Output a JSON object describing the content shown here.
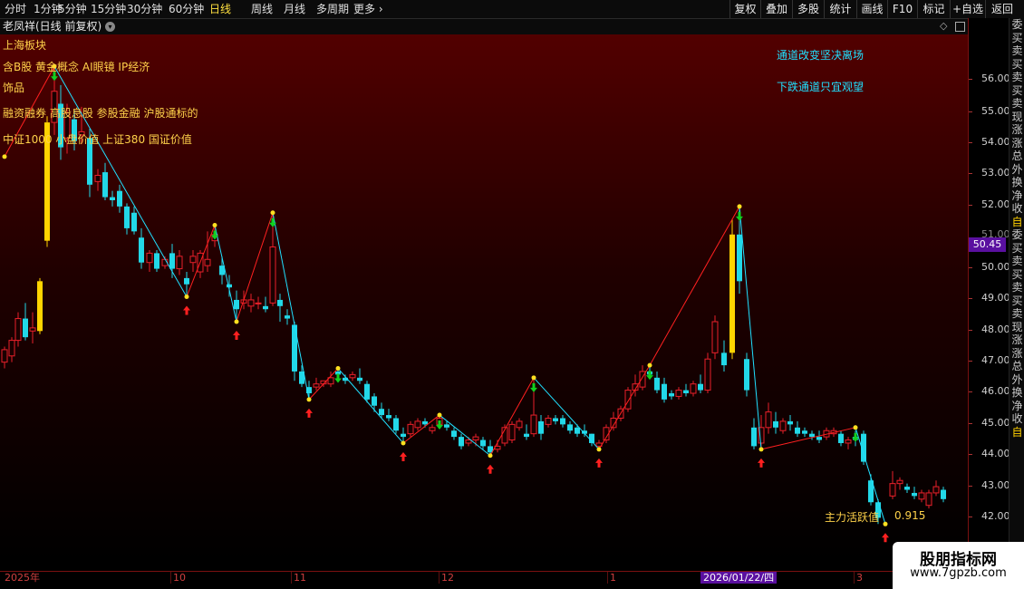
{
  "period_tabs": [
    {
      "label": "分时",
      "active": false
    },
    {
      "label": "1分钟",
      "active": false
    },
    {
      "label": "5分钟",
      "active": false
    },
    {
      "label": "15分钟",
      "active": false
    },
    {
      "label": "30分钟",
      "active": false
    },
    {
      "label": "60分钟",
      "active": false
    },
    {
      "label": "日线",
      "active": true
    },
    {
      "label": "周线",
      "active": false
    },
    {
      "label": "月线",
      "active": false
    },
    {
      "label": "多周期",
      "active": false
    },
    {
      "label": "更多 ›",
      "active": false
    }
  ],
  "toolbar": [
    "复权",
    "叠加",
    "多股",
    "统计",
    "画线",
    "F10",
    "标记",
    "+自选",
    "返回"
  ],
  "stock_title": "老凤祥(日线 前复权)",
  "annotations": {
    "lines": [
      "上海板块",
      "含B股 黄金概念 AI眼镜 IP经济",
      "饰品",
      "融资融券 高股息股 参股金融 沪股通标的",
      "中证1000 小盘价值 上证380 国证价值"
    ],
    "channel_msgs": [
      "通道改变坚决离场",
      "下跌通道只宜观望"
    ]
  },
  "indicator": {
    "label": "主力活跃值",
    "value": "0.915"
  },
  "price_axis": {
    "ticks": [
      "56.00",
      "55.00",
      "54.00",
      "53.00",
      "52.00",
      "51.00",
      "50.00",
      "49.00",
      "48.00",
      "47.00",
      "46.00",
      "45.00",
      "44.00",
      "43.00",
      "42.00"
    ],
    "current": "50.45"
  },
  "date_axis": {
    "labels": [
      "2025年",
      "10",
      "11",
      "12",
      "1",
      "3"
    ],
    "highlight": "2026/01/22/四"
  },
  "right_strip": [
    "委",
    "买",
    "卖",
    "买",
    "卖",
    "买",
    "卖",
    "现",
    "涨",
    "涨",
    "总",
    "外",
    "换",
    "净",
    "收",
    "自",
    "委",
    "买",
    "卖",
    "买",
    "卖",
    "买",
    "卖",
    "现",
    "涨",
    "涨",
    "总",
    "外",
    "换",
    "净",
    "收",
    "自"
  ],
  "watermark": {
    "title": "股朋指标网",
    "url": "www.7gpzb.com"
  },
  "colors": {
    "up": "#e8202a",
    "down": "#22d8e8",
    "limit_up": "#ffd400",
    "zigzag_up": "#ff2020",
    "zigzag_down": "#20e0ff",
    "buy_arrow": "#ff2020",
    "sell_arrow": "#10d020"
  },
  "chart_data": {
    "type": "candlestick",
    "ylim": [
      41.5,
      57.2
    ],
    "candles": [
      {
        "x": 5,
        "o": 46.9,
        "h": 47.4,
        "l": 46.7,
        "c": 47.3
      },
      {
        "x": 13,
        "o": 47.1,
        "h": 47.7,
        "l": 46.9,
        "c": 47.6
      },
      {
        "x": 20,
        "o": 47.6,
        "h": 48.5,
        "l": 47.4,
        "c": 48.3
      },
      {
        "x": 28,
        "o": 48.3,
        "h": 48.8,
        "l": 47.6,
        "c": 47.7
      },
      {
        "x": 36,
        "o": 47.9,
        "h": 48.5,
        "l": 47.5,
        "c": 48.0
      },
      {
        "x": 44,
        "o": 47.9,
        "h": 49.6,
        "l": 47.8,
        "c": 49.5
      },
      {
        "x": 52,
        "o": 50.8,
        "h": 54.8,
        "l": 50.6,
        "c": 54.6
      },
      {
        "x": 60,
        "o": 54.6,
        "h": 56.4,
        "l": 54.2,
        "c": 55.6
      },
      {
        "x": 67,
        "o": 55.2,
        "h": 55.8,
        "l": 53.4,
        "c": 53.8
      },
      {
        "x": 74,
        "o": 54.1,
        "h": 55.2,
        "l": 53.6,
        "c": 54.9
      },
      {
        "x": 82,
        "o": 54.7,
        "h": 55.0,
        "l": 53.7,
        "c": 54.0
      },
      {
        "x": 90,
        "o": 54.2,
        "h": 55.1,
        "l": 53.9,
        "c": 54.3
      },
      {
        "x": 99,
        "o": 54.1,
        "h": 54.4,
        "l": 52.2,
        "c": 52.6
      },
      {
        "x": 108,
        "o": 52.7,
        "h": 53.1,
        "l": 52.4,
        "c": 52.9
      },
      {
        "x": 116,
        "o": 53.0,
        "h": 53.3,
        "l": 52.1,
        "c": 52.2
      },
      {
        "x": 124,
        "o": 52.2,
        "h": 52.4,
        "l": 51.9,
        "c": 52.1
      },
      {
        "x": 132,
        "o": 52.4,
        "h": 52.6,
        "l": 51.7,
        "c": 51.9
      },
      {
        "x": 140,
        "o": 51.9,
        "h": 52.0,
        "l": 51.0,
        "c": 51.2
      },
      {
        "x": 148,
        "o": 51.7,
        "h": 51.9,
        "l": 51.0,
        "c": 51.1
      },
      {
        "x": 156,
        "o": 50.9,
        "h": 51.2,
        "l": 49.9,
        "c": 50.1
      },
      {
        "x": 165,
        "o": 50.1,
        "h": 50.5,
        "l": 49.8,
        "c": 50.4
      },
      {
        "x": 173,
        "o": 50.4,
        "h": 50.5,
        "l": 49.8,
        "c": 49.9
      },
      {
        "x": 182,
        "o": 50.0,
        "h": 50.3,
        "l": 49.9,
        "c": 50.2
      },
      {
        "x": 190,
        "o": 50.4,
        "h": 50.7,
        "l": 49.6,
        "c": 49.9
      },
      {
        "x": 198,
        "o": 49.9,
        "h": 50.5,
        "l": 49.7,
        "c": 50.3
      },
      {
        "x": 206,
        "o": 49.6,
        "h": 49.8,
        "l": 49.0,
        "c": 49.4
      },
      {
        "x": 213,
        "o": 50.1,
        "h": 50.5,
        "l": 49.8,
        "c": 50.3
      },
      {
        "x": 221,
        "o": 49.8,
        "h": 50.5,
        "l": 49.6,
        "c": 50.4
      },
      {
        "x": 229,
        "o": 50.0,
        "h": 51.1,
        "l": 49.8,
        "c": 50.2
      },
      {
        "x": 237,
        "o": 50.8,
        "h": 51.3,
        "l": 50.6,
        "c": 51.0
      },
      {
        "x": 245,
        "o": 50.0,
        "h": 50.3,
        "l": 49.4,
        "c": 49.7
      },
      {
        "x": 253,
        "o": 49.4,
        "h": 49.7,
        "l": 49.0,
        "c": 49.3
      },
      {
        "x": 261,
        "o": 48.9,
        "h": 49.2,
        "l": 48.2,
        "c": 48.6
      },
      {
        "x": 269,
        "o": 48.8,
        "h": 49.2,
        "l": 48.6,
        "c": 48.9
      },
      {
        "x": 277,
        "o": 48.7,
        "h": 49.1,
        "l": 48.5,
        "c": 48.9
      },
      {
        "x": 285,
        "o": 48.8,
        "h": 49.0,
        "l": 48.6,
        "c": 48.8
      },
      {
        "x": 293,
        "o": 48.7,
        "h": 49.0,
        "l": 48.5,
        "c": 48.6
      },
      {
        "x": 301,
        "o": 48.8,
        "h": 51.7,
        "l": 48.7,
        "c": 50.6
      },
      {
        "x": 309,
        "o": 48.9,
        "h": 49.1,
        "l": 48.2,
        "c": 48.7
      },
      {
        "x": 317,
        "o": 48.4,
        "h": 48.6,
        "l": 48.1,
        "c": 48.3
      },
      {
        "x": 325,
        "o": 48.1,
        "h": 48.2,
        "l": 46.3,
        "c": 46.6
      },
      {
        "x": 333,
        "o": 46.6,
        "h": 46.8,
        "l": 46.1,
        "c": 46.2
      },
      {
        "x": 341,
        "o": 46.1,
        "h": 46.3,
        "l": 45.7,
        "c": 45.9
      },
      {
        "x": 349,
        "o": 46.1,
        "h": 46.4,
        "l": 46.0,
        "c": 46.2
      },
      {
        "x": 357,
        "o": 46.2,
        "h": 46.3,
        "l": 46.1,
        "c": 46.3
      },
      {
        "x": 365,
        "o": 46.2,
        "h": 46.6,
        "l": 46.1,
        "c": 46.4
      },
      {
        "x": 373,
        "o": 46.6,
        "h": 46.7,
        "l": 46.3,
        "c": 46.5
      },
      {
        "x": 381,
        "o": 46.4,
        "h": 46.5,
        "l": 46.2,
        "c": 46.3
      },
      {
        "x": 389,
        "o": 46.4,
        "h": 46.6,
        "l": 46.3,
        "c": 46.5
      },
      {
        "x": 397,
        "o": 46.4,
        "h": 46.7,
        "l": 46.2,
        "c": 46.3
      },
      {
        "x": 405,
        "o": 46.2,
        "h": 46.3,
        "l": 45.6,
        "c": 45.7
      },
      {
        "x": 413,
        "o": 45.8,
        "h": 45.9,
        "l": 45.3,
        "c": 45.5
      },
      {
        "x": 421,
        "o": 45.4,
        "h": 45.6,
        "l": 45.1,
        "c": 45.2
      },
      {
        "x": 429,
        "o": 45.2,
        "h": 45.4,
        "l": 45.0,
        "c": 45.1
      },
      {
        "x": 437,
        "o": 45.1,
        "h": 45.2,
        "l": 44.6,
        "c": 44.7
      },
      {
        "x": 445,
        "o": 44.6,
        "h": 44.8,
        "l": 44.3,
        "c": 44.5
      },
      {
        "x": 453,
        "o": 44.6,
        "h": 45.0,
        "l": 44.5,
        "c": 44.9
      },
      {
        "x": 461,
        "o": 44.8,
        "h": 45.1,
        "l": 44.7,
        "c": 45.0
      },
      {
        "x": 469,
        "o": 45.0,
        "h": 45.1,
        "l": 44.8,
        "c": 44.9
      },
      {
        "x": 477,
        "o": 44.7,
        "h": 44.9,
        "l": 44.6,
        "c": 44.8
      },
      {
        "x": 485,
        "o": 44.9,
        "h": 45.2,
        "l": 44.8,
        "c": 45.1
      },
      {
        "x": 493,
        "o": 44.9,
        "h": 45.0,
        "l": 44.7,
        "c": 44.8
      },
      {
        "x": 501,
        "o": 44.7,
        "h": 44.8,
        "l": 44.4,
        "c": 44.5
      },
      {
        "x": 509,
        "o": 44.5,
        "h": 44.6,
        "l": 44.1,
        "c": 44.2
      },
      {
        "x": 517,
        "o": 44.3,
        "h": 44.5,
        "l": 44.2,
        "c": 44.4
      },
      {
        "x": 525,
        "o": 44.4,
        "h": 44.6,
        "l": 44.2,
        "c": 44.5
      },
      {
        "x": 533,
        "o": 44.4,
        "h": 44.5,
        "l": 44.1,
        "c": 44.2
      },
      {
        "x": 541,
        "o": 44.2,
        "h": 44.4,
        "l": 43.9,
        "c": 44.0
      },
      {
        "x": 549,
        "o": 44.1,
        "h": 44.4,
        "l": 44.0,
        "c": 44.2
      },
      {
        "x": 557,
        "o": 44.3,
        "h": 44.9,
        "l": 44.2,
        "c": 44.8
      },
      {
        "x": 565,
        "o": 44.4,
        "h": 45.0,
        "l": 44.3,
        "c": 44.9
      },
      {
        "x": 573,
        "o": 44.8,
        "h": 45.1,
        "l": 44.7,
        "c": 45.0
      },
      {
        "x": 581,
        "o": 44.6,
        "h": 44.9,
        "l": 44.4,
        "c": 44.5
      },
      {
        "x": 589,
        "o": 44.6,
        "h": 46.4,
        "l": 44.5,
        "c": 45.2
      },
      {
        "x": 597,
        "o": 45.0,
        "h": 45.2,
        "l": 44.4,
        "c": 44.6
      },
      {
        "x": 605,
        "o": 44.9,
        "h": 45.2,
        "l": 44.8,
        "c": 45.1
      },
      {
        "x": 613,
        "o": 45.1,
        "h": 45.2,
        "l": 44.9,
        "c": 45.0
      },
      {
        "x": 621,
        "o": 45.1,
        "h": 45.2,
        "l": 44.8,
        "c": 44.9
      },
      {
        "x": 629,
        "o": 44.9,
        "h": 45.0,
        "l": 44.6,
        "c": 44.7
      },
      {
        "x": 637,
        "o": 44.8,
        "h": 44.9,
        "l": 44.5,
        "c": 44.6
      },
      {
        "x": 645,
        "o": 44.7,
        "h": 44.9,
        "l": 44.5,
        "c": 44.6
      },
      {
        "x": 653,
        "o": 44.6,
        "h": 44.6,
        "l": 44.2,
        "c": 44.3
      },
      {
        "x": 661,
        "o": 44.2,
        "h": 44.4,
        "l": 44.1,
        "c": 44.3
      },
      {
        "x": 669,
        "o": 44.4,
        "h": 44.9,
        "l": 44.3,
        "c": 44.8
      },
      {
        "x": 677,
        "o": 44.8,
        "h": 45.3,
        "l": 44.7,
        "c": 45.1
      },
      {
        "x": 685,
        "o": 45.1,
        "h": 45.5,
        "l": 45.0,
        "c": 45.4
      },
      {
        "x": 693,
        "o": 45.4,
        "h": 46.1,
        "l": 45.3,
        "c": 46.0
      },
      {
        "x": 701,
        "o": 46.0,
        "h": 46.5,
        "l": 45.8,
        "c": 46.2
      },
      {
        "x": 709,
        "o": 46.1,
        "h": 46.8,
        "l": 46.0,
        "c": 46.6
      },
      {
        "x": 717,
        "o": 46.6,
        "h": 46.8,
        "l": 46.4,
        "c": 46.5
      },
      {
        "x": 725,
        "o": 46.4,
        "h": 46.6,
        "l": 45.9,
        "c": 46.0
      },
      {
        "x": 733,
        "o": 46.2,
        "h": 46.4,
        "l": 45.6,
        "c": 45.7
      },
      {
        "x": 741,
        "o": 45.9,
        "h": 46.0,
        "l": 45.7,
        "c": 45.8
      },
      {
        "x": 749,
        "o": 45.8,
        "h": 46.1,
        "l": 45.7,
        "c": 46.0
      },
      {
        "x": 757,
        "o": 46.0,
        "h": 46.2,
        "l": 45.8,
        "c": 45.9
      },
      {
        "x": 765,
        "o": 45.9,
        "h": 46.3,
        "l": 45.8,
        "c": 46.2
      },
      {
        "x": 773,
        "o": 46.2,
        "h": 46.5,
        "l": 45.9,
        "c": 46.0
      },
      {
        "x": 781,
        "o": 46.0,
        "h": 47.2,
        "l": 45.9,
        "c": 47.0
      },
      {
        "x": 789,
        "o": 47.2,
        "h": 48.4,
        "l": 47.0,
        "c": 48.2
      },
      {
        "x": 799,
        "o": 47.2,
        "h": 47.6,
        "l": 46.6,
        "c": 46.8
      },
      {
        "x": 808,
        "o": 47.2,
        "h": 51.5,
        "l": 47.0,
        "c": 51.0
      },
      {
        "x": 816,
        "o": 51.0,
        "h": 51.9,
        "l": 49.1,
        "c": 49.5
      },
      {
        "x": 824,
        "o": 47.0,
        "h": 47.2,
        "l": 45.8,
        "c": 46.0
      },
      {
        "x": 832,
        "o": 44.8,
        "h": 45.1,
        "l": 44.1,
        "c": 44.2
      },
      {
        "x": 840,
        "o": 44.3,
        "h": 45.2,
        "l": 44.1,
        "c": 44.8
      },
      {
        "x": 848,
        "o": 44.8,
        "h": 45.6,
        "l": 44.6,
        "c": 45.3
      },
      {
        "x": 856,
        "o": 45.0,
        "h": 45.3,
        "l": 44.6,
        "c": 44.8
      },
      {
        "x": 864,
        "o": 44.7,
        "h": 45.1,
        "l": 44.6,
        "c": 45.0
      },
      {
        "x": 872,
        "o": 45.0,
        "h": 45.2,
        "l": 44.7,
        "c": 44.9
      },
      {
        "x": 880,
        "o": 44.8,
        "h": 45.0,
        "l": 44.5,
        "c": 44.6
      },
      {
        "x": 888,
        "o": 44.7,
        "h": 44.8,
        "l": 44.5,
        "c": 44.6
      },
      {
        "x": 896,
        "o": 44.6,
        "h": 44.7,
        "l": 44.4,
        "c": 44.5
      },
      {
        "x": 904,
        "o": 44.5,
        "h": 44.7,
        "l": 44.3,
        "c": 44.4
      },
      {
        "x": 912,
        "o": 44.5,
        "h": 44.8,
        "l": 44.4,
        "c": 44.7
      },
      {
        "x": 920,
        "o": 44.6,
        "h": 44.8,
        "l": 44.5,
        "c": 44.7
      },
      {
        "x": 928,
        "o": 44.6,
        "h": 44.7,
        "l": 44.2,
        "c": 44.3
      },
      {
        "x": 936,
        "o": 44.3,
        "h": 44.5,
        "l": 44.1,
        "c": 44.4
      },
      {
        "x": 944,
        "o": 44.5,
        "h": 44.7,
        "l": 44.2,
        "c": 44.4
      },
      {
        "x": 953,
        "o": 44.6,
        "h": 44.7,
        "l": 43.6,
        "c": 43.7
      },
      {
        "x": 961,
        "o": 43.1,
        "h": 43.3,
        "l": 42.3,
        "c": 42.4
      },
      {
        "x": 969,
        "o": 42.4,
        "h": 42.5,
        "l": 41.7,
        "c": 41.9
      },
      {
        "x": 985,
        "o": 42.6,
        "h": 43.4,
        "l": 42.5,
        "c": 43.0
      },
      {
        "x": 993,
        "o": 43.0,
        "h": 43.2,
        "l": 42.8,
        "c": 43.1
      },
      {
        "x": 1001,
        "o": 42.9,
        "h": 43.0,
        "l": 42.7,
        "c": 42.8
      },
      {
        "x": 1009,
        "o": 42.7,
        "h": 42.9,
        "l": 42.5,
        "c": 42.6
      },
      {
        "x": 1017,
        "o": 42.5,
        "h": 42.8,
        "l": 42.4,
        "c": 42.7
      },
      {
        "x": 1025,
        "o": 42.3,
        "h": 42.8,
        "l": 42.2,
        "c": 42.7
      },
      {
        "x": 1033,
        "o": 42.7,
        "h": 43.1,
        "l": 42.6,
        "c": 42.9
      },
      {
        "x": 1041,
        "o": 42.8,
        "h": 42.9,
        "l": 42.4,
        "c": 42.5
      }
    ],
    "limit_up_x": [
      44,
      52,
      808
    ],
    "zigzag": [
      [
        5,
        53.5
      ],
      [
        60,
        56.4
      ],
      [
        206,
        49.0
      ],
      [
        237,
        51.3
      ],
      [
        261,
        48.2
      ],
      [
        301,
        51.7
      ],
      [
        341,
        45.7
      ],
      [
        373,
        46.7
      ],
      [
        445,
        44.3
      ],
      [
        485,
        45.2
      ],
      [
        541,
        43.9
      ],
      [
        589,
        46.4
      ],
      [
        661,
        44.1
      ],
      [
        717,
        46.8
      ],
      [
        816,
        51.9
      ],
      [
        840,
        44.1
      ],
      [
        944,
        44.8
      ],
      [
        977,
        41.7
      ]
    ],
    "buy_arrows": [
      [
        206,
        49.0
      ],
      [
        261,
        48.2
      ],
      [
        341,
        45.7
      ],
      [
        445,
        44.3
      ],
      [
        541,
        43.9
      ],
      [
        661,
        44.1
      ],
      [
        840,
        44.1
      ],
      [
        977,
        41.7
      ]
    ],
    "sell_arrows": [
      [
        60,
        56.4
      ],
      [
        237,
        51.3
      ],
      [
        301,
        51.7
      ],
      [
        373,
        46.7
      ],
      [
        485,
        45.2
      ],
      [
        589,
        46.4
      ],
      [
        717,
        46.8
      ],
      [
        816,
        51.9
      ],
      [
        944,
        44.8
      ]
    ]
  }
}
